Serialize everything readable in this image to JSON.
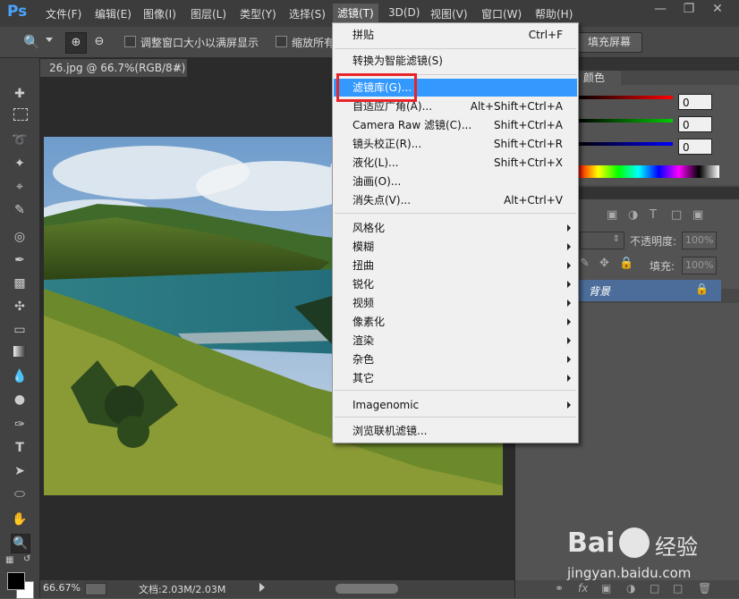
{
  "app": {
    "logo": "Ps"
  },
  "menubar": {
    "items": [
      "文件(F)",
      "编辑(E)",
      "图像(I)",
      "图层(L)",
      "类型(Y)",
      "选择(S)",
      "滤镜(T)",
      "3D(D)",
      "视图(V)",
      "窗口(W)",
      "帮助(H)"
    ],
    "active": "滤镜(T)"
  },
  "options": {
    "resize_window": "调整窗口大小以满屏显示",
    "zoom_all": "缩放所有",
    "fill_screen": "填充屏幕"
  },
  "document": {
    "tab_title": "26.jpg @ 66.7%(RGB/8#)",
    "zoom": "66.67%",
    "doc_info": "文档:2.03M/2.03M"
  },
  "color_panel": {
    "tab": "颜色",
    "r": "0",
    "g": "0",
    "b": "0"
  },
  "layers_panel": {
    "opacity_label": "不透明度:",
    "opacity": "100%",
    "fill_label": "填充:",
    "fill": "100%",
    "layer_name": "背景"
  },
  "filter_menu": {
    "items": [
      {
        "label": "拼贴",
        "shortcut": "Ctrl+F"
      },
      {
        "label": "转换为智能滤镜(S)",
        "shortcut": ""
      },
      {
        "label": "滤镜库(G)...",
        "shortcut": "",
        "highlighted": true
      },
      {
        "label": "自适应广角(A)...",
        "shortcut": "Alt+Shift+Ctrl+A"
      },
      {
        "label": "Camera Raw 滤镜(C)...",
        "shortcut": "Shift+Ctrl+A"
      },
      {
        "label": "镜头校正(R)...",
        "shortcut": "Shift+Ctrl+R"
      },
      {
        "label": "液化(L)...",
        "shortcut": "Shift+Ctrl+X"
      },
      {
        "label": "油画(O)...",
        "shortcut": ""
      },
      {
        "label": "消失点(V)...",
        "shortcut": "Alt+Ctrl+V"
      },
      {
        "label": "风格化",
        "submenu": true
      },
      {
        "label": "模糊",
        "submenu": true
      },
      {
        "label": "扭曲",
        "submenu": true
      },
      {
        "label": "锐化",
        "submenu": true
      },
      {
        "label": "视频",
        "submenu": true
      },
      {
        "label": "像素化",
        "submenu": true
      },
      {
        "label": "渲染",
        "submenu": true
      },
      {
        "label": "杂色",
        "submenu": true
      },
      {
        "label": "其它",
        "submenu": true
      },
      {
        "label": "Imagenomic",
        "submenu": true
      },
      {
        "label": "浏览联机滤镜..."
      }
    ]
  },
  "watermark": {
    "brand": "Bai",
    "brand2": "经验",
    "url": "jingyan.baidu.com"
  },
  "colors": {
    "highlight": "#3399ff",
    "annotation_box": "#e8242b"
  }
}
